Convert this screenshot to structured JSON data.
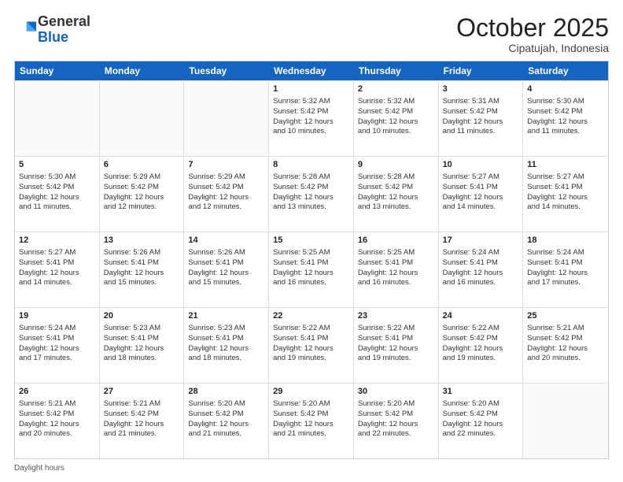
{
  "logo": {
    "general": "General",
    "blue": "Blue"
  },
  "header": {
    "month": "October 2025",
    "location": "Cipatujah, Indonesia"
  },
  "days": [
    "Sunday",
    "Monday",
    "Tuesday",
    "Wednesday",
    "Thursday",
    "Friday",
    "Saturday"
  ],
  "weeks": [
    [
      {
        "day": "",
        "lines": []
      },
      {
        "day": "",
        "lines": []
      },
      {
        "day": "",
        "lines": []
      },
      {
        "day": "1",
        "lines": [
          "Sunrise: 5:32 AM",
          "Sunset: 5:42 PM",
          "Daylight: 12 hours",
          "and 10 minutes."
        ]
      },
      {
        "day": "2",
        "lines": [
          "Sunrise: 5:32 AM",
          "Sunset: 5:42 PM",
          "Daylight: 12 hours",
          "and 10 minutes."
        ]
      },
      {
        "day": "3",
        "lines": [
          "Sunrise: 5:31 AM",
          "Sunset: 5:42 PM",
          "Daylight: 12 hours",
          "and 11 minutes."
        ]
      },
      {
        "day": "4",
        "lines": [
          "Sunrise: 5:30 AM",
          "Sunset: 5:42 PM",
          "Daylight: 12 hours",
          "and 11 minutes."
        ]
      }
    ],
    [
      {
        "day": "5",
        "lines": [
          "Sunrise: 5:30 AM",
          "Sunset: 5:42 PM",
          "Daylight: 12 hours",
          "and 11 minutes."
        ]
      },
      {
        "day": "6",
        "lines": [
          "Sunrise: 5:29 AM",
          "Sunset: 5:42 PM",
          "Daylight: 12 hours",
          "and 12 minutes."
        ]
      },
      {
        "day": "7",
        "lines": [
          "Sunrise: 5:29 AM",
          "Sunset: 5:42 PM",
          "Daylight: 12 hours",
          "and 12 minutes."
        ]
      },
      {
        "day": "8",
        "lines": [
          "Sunrise: 5:28 AM",
          "Sunset: 5:42 PM",
          "Daylight: 12 hours",
          "and 13 minutes."
        ]
      },
      {
        "day": "9",
        "lines": [
          "Sunrise: 5:28 AM",
          "Sunset: 5:42 PM",
          "Daylight: 12 hours",
          "and 13 minutes."
        ]
      },
      {
        "day": "10",
        "lines": [
          "Sunrise: 5:27 AM",
          "Sunset: 5:41 PM",
          "Daylight: 12 hours",
          "and 14 minutes."
        ]
      },
      {
        "day": "11",
        "lines": [
          "Sunrise: 5:27 AM",
          "Sunset: 5:41 PM",
          "Daylight: 12 hours",
          "and 14 minutes."
        ]
      }
    ],
    [
      {
        "day": "12",
        "lines": [
          "Sunrise: 5:27 AM",
          "Sunset: 5:41 PM",
          "Daylight: 12 hours",
          "and 14 minutes."
        ]
      },
      {
        "day": "13",
        "lines": [
          "Sunrise: 5:26 AM",
          "Sunset: 5:41 PM",
          "Daylight: 12 hours",
          "and 15 minutes."
        ]
      },
      {
        "day": "14",
        "lines": [
          "Sunrise: 5:26 AM",
          "Sunset: 5:41 PM",
          "Daylight: 12 hours",
          "and 15 minutes."
        ]
      },
      {
        "day": "15",
        "lines": [
          "Sunrise: 5:25 AM",
          "Sunset: 5:41 PM",
          "Daylight: 12 hours",
          "and 16 minutes."
        ]
      },
      {
        "day": "16",
        "lines": [
          "Sunrise: 5:25 AM",
          "Sunset: 5:41 PM",
          "Daylight: 12 hours",
          "and 16 minutes."
        ]
      },
      {
        "day": "17",
        "lines": [
          "Sunrise: 5:24 AM",
          "Sunset: 5:41 PM",
          "Daylight: 12 hours",
          "and 16 minutes."
        ]
      },
      {
        "day": "18",
        "lines": [
          "Sunrise: 5:24 AM",
          "Sunset: 5:41 PM",
          "Daylight: 12 hours",
          "and 17 minutes."
        ]
      }
    ],
    [
      {
        "day": "19",
        "lines": [
          "Sunrise: 5:24 AM",
          "Sunset: 5:41 PM",
          "Daylight: 12 hours",
          "and 17 minutes."
        ]
      },
      {
        "day": "20",
        "lines": [
          "Sunrise: 5:23 AM",
          "Sunset: 5:41 PM",
          "Daylight: 12 hours",
          "and 18 minutes."
        ]
      },
      {
        "day": "21",
        "lines": [
          "Sunrise: 5:23 AM",
          "Sunset: 5:41 PM",
          "Daylight: 12 hours",
          "and 18 minutes."
        ]
      },
      {
        "day": "22",
        "lines": [
          "Sunrise: 5:22 AM",
          "Sunset: 5:41 PM",
          "Daylight: 12 hours",
          "and 19 minutes."
        ]
      },
      {
        "day": "23",
        "lines": [
          "Sunrise: 5:22 AM",
          "Sunset: 5:41 PM",
          "Daylight: 12 hours",
          "and 19 minutes."
        ]
      },
      {
        "day": "24",
        "lines": [
          "Sunrise: 5:22 AM",
          "Sunset: 5:42 PM",
          "Daylight: 12 hours",
          "and 19 minutes."
        ]
      },
      {
        "day": "25",
        "lines": [
          "Sunrise: 5:21 AM",
          "Sunset: 5:42 PM",
          "Daylight: 12 hours",
          "and 20 minutes."
        ]
      }
    ],
    [
      {
        "day": "26",
        "lines": [
          "Sunrise: 5:21 AM",
          "Sunset: 5:42 PM",
          "Daylight: 12 hours",
          "and 20 minutes."
        ]
      },
      {
        "day": "27",
        "lines": [
          "Sunrise: 5:21 AM",
          "Sunset: 5:42 PM",
          "Daylight: 12 hours",
          "and 21 minutes."
        ]
      },
      {
        "day": "28",
        "lines": [
          "Sunrise: 5:20 AM",
          "Sunset: 5:42 PM",
          "Daylight: 12 hours",
          "and 21 minutes."
        ]
      },
      {
        "day": "29",
        "lines": [
          "Sunrise: 5:20 AM",
          "Sunset: 5:42 PM",
          "Daylight: 12 hours",
          "and 21 minutes."
        ]
      },
      {
        "day": "30",
        "lines": [
          "Sunrise: 5:20 AM",
          "Sunset: 5:42 PM",
          "Daylight: 12 hours",
          "and 22 minutes."
        ]
      },
      {
        "day": "31",
        "lines": [
          "Sunrise: 5:20 AM",
          "Sunset: 5:42 PM",
          "Daylight: 12 hours",
          "and 22 minutes."
        ]
      },
      {
        "day": "",
        "lines": []
      }
    ]
  ],
  "footer": {
    "text": "Daylight hours"
  }
}
